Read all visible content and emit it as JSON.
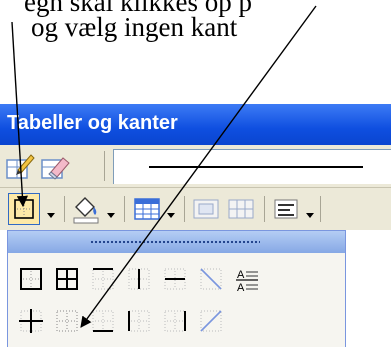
{
  "caption": {
    "line1": "egn skal klikkes op p",
    "line2": "og vælg  ingen kant"
  },
  "window": {
    "title": "Tabeller og kanter"
  },
  "toolbar1": {
    "icons": [
      "draw-table-icon",
      "eraser-icon",
      "line-style-box"
    ]
  },
  "toolbar2": {
    "icons": [
      "border-button",
      "shading-color-button",
      "insert-table-button",
      "merge-cells-icon",
      "split-cells-icon",
      "align-button"
    ]
  },
  "border_popup": {
    "options": [
      "outside-border",
      "all-borders",
      "top-border",
      "inside-vertical",
      "inside-horizontal",
      "diagonal-down",
      "horizontal-line",
      "inside-border",
      "no-border",
      "bottom-border",
      "left-border",
      "right-border",
      "diagonal-up"
    ]
  }
}
